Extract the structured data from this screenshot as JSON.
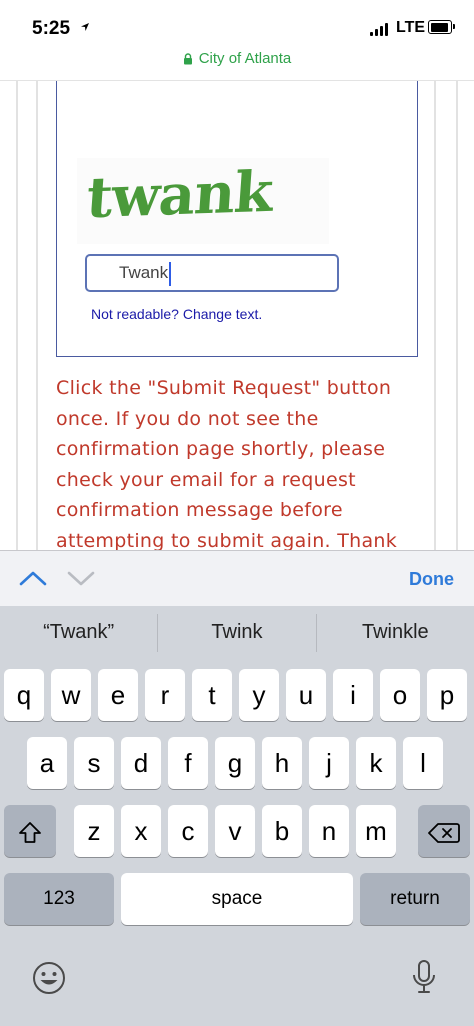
{
  "status": {
    "time": "5:25",
    "network": "LTE",
    "location_icon": "location-arrow-icon",
    "battery_icon": "battery-icon",
    "signal_icon": "signal-bars-icon"
  },
  "browser": {
    "url_text": "City of Atlanta",
    "lock_icon": "lock-icon"
  },
  "captcha": {
    "word": "twank",
    "input_value": "Twank",
    "change_link": "Not readable? Change text."
  },
  "instructions": {
    "lines": [
      "Click the \"Submit Request\" button",
      "once. If you do not see the",
      "confirmation page shortly, please",
      "check your email for a request",
      "confirmation message before",
      "attempting to submit again. Thank"
    ]
  },
  "accessory": {
    "prev_icon": "chevron-up-icon",
    "next_icon": "chevron-down-icon",
    "done_label": "Done"
  },
  "keyboard": {
    "suggestions": [
      "“Twank”",
      "Twink",
      "Twinkle"
    ],
    "row1": [
      "q",
      "w",
      "e",
      "r",
      "t",
      "y",
      "u",
      "i",
      "o",
      "p"
    ],
    "row2": [
      "a",
      "s",
      "d",
      "f",
      "g",
      "h",
      "j",
      "k",
      "l"
    ],
    "row3": [
      "z",
      "x",
      "c",
      "v",
      "b",
      "n",
      "m"
    ],
    "numbers_label": "123",
    "space_label": "space",
    "return_label": "return",
    "shift_icon": "shift-icon",
    "delete_icon": "backspace-icon",
    "emoji_icon": "emoji-icon",
    "mic_icon": "microphone-icon"
  },
  "colors": {
    "url_green": "#2fa24a",
    "instruction_red": "#c0392b",
    "link_blue": "#1a1aa8",
    "done_blue": "#2f7bd9",
    "keyboard_bg": "#d1d5db"
  }
}
